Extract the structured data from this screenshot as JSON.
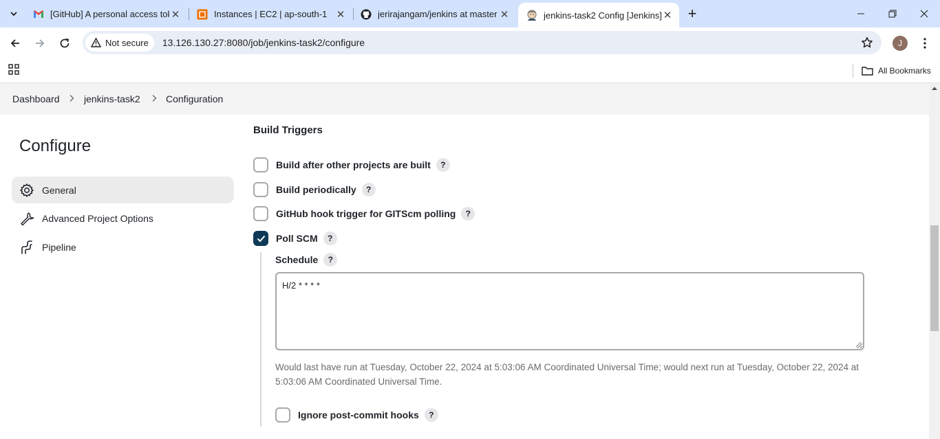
{
  "browser": {
    "tabs": [
      {
        "title": "[GitHub] A personal access toke",
        "icon": "gmail-icon"
      },
      {
        "title": "Instances | EC2 | ap-south-1",
        "icon": "aws-icon"
      },
      {
        "title": "jerirajangam/jenkins at master",
        "icon": "github-icon"
      },
      {
        "title": "jenkins-task2 Config [Jenkins]",
        "icon": "jenkins-icon"
      }
    ],
    "security_label": "Not secure",
    "url": "13.126.130.27:8080/job/jenkins-task2/configure",
    "profile_initial": "J",
    "all_bookmarks": "All Bookmarks"
  },
  "breadcrumb": [
    "Dashboard",
    "jenkins-task2",
    "Configuration"
  ],
  "sidebar": {
    "title": "Configure",
    "items": [
      {
        "label": "General",
        "icon": "gear-icon",
        "active": true
      },
      {
        "label": "Advanced Project Options",
        "icon": "wrench-icon",
        "active": false
      },
      {
        "label": "Pipeline",
        "icon": "pipeline-icon",
        "active": false
      }
    ]
  },
  "build_triggers": {
    "title": "Build Triggers",
    "options": [
      {
        "label": "Build after other projects are built",
        "checked": false
      },
      {
        "label": "Build periodically",
        "checked": false
      },
      {
        "label": "GitHub hook trigger for GITScm polling",
        "checked": false
      },
      {
        "label": "Poll SCM",
        "checked": true
      }
    ],
    "schedule_label": "Schedule",
    "schedule_value": "H/2 * * * *",
    "schedule_info": "Would last have run at Tuesday, October 22, 2024 at 5:03:06 AM Coordinated Universal Time; would next run at Tuesday, October 22, 2024 at 5:03:06 AM Coordinated Universal Time.",
    "ignore_hooks_label": "Ignore post-commit hooks",
    "help_glyph": "?"
  },
  "colors": {
    "tabstrip": "#d3e3fd",
    "checkbox_checked": "#0f3a57",
    "active_sidebar": "#ececed"
  }
}
